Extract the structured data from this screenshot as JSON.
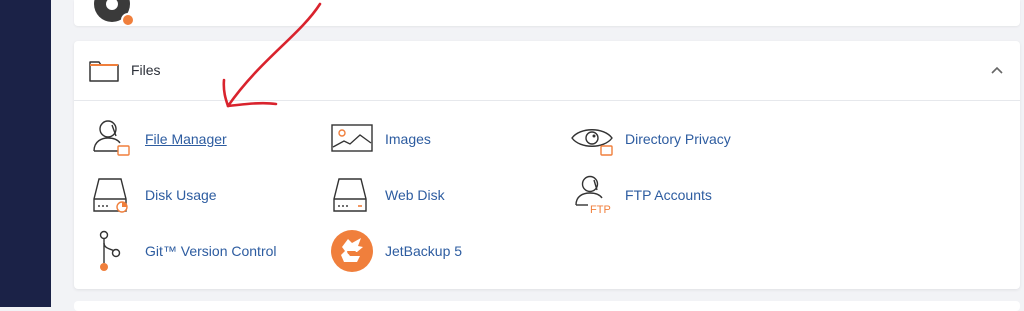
{
  "colors": {
    "sidebar": "#1b2247",
    "link": "#2d5ca0",
    "accent": "#f07f3c",
    "annotation": "#d9232d"
  },
  "files_section": {
    "title": "Files",
    "collapse_icon": "chevron-up-icon",
    "items": [
      {
        "label": "File Manager",
        "icon": "file-manager-icon"
      },
      {
        "label": "Images",
        "icon": "images-icon"
      },
      {
        "label": "Directory Privacy",
        "icon": "directory-privacy-icon"
      },
      {
        "label": "Disk Usage",
        "icon": "disk-usage-icon"
      },
      {
        "label": "Web Disk",
        "icon": "web-disk-icon"
      },
      {
        "label": "FTP Accounts",
        "icon": "ftp-accounts-icon"
      },
      {
        "label": "Git™ Version Control",
        "icon": "git-version-control-icon"
      },
      {
        "label": "JetBackup 5",
        "icon": "jetbackup-icon"
      }
    ],
    "ftp_badge": "FTP"
  }
}
